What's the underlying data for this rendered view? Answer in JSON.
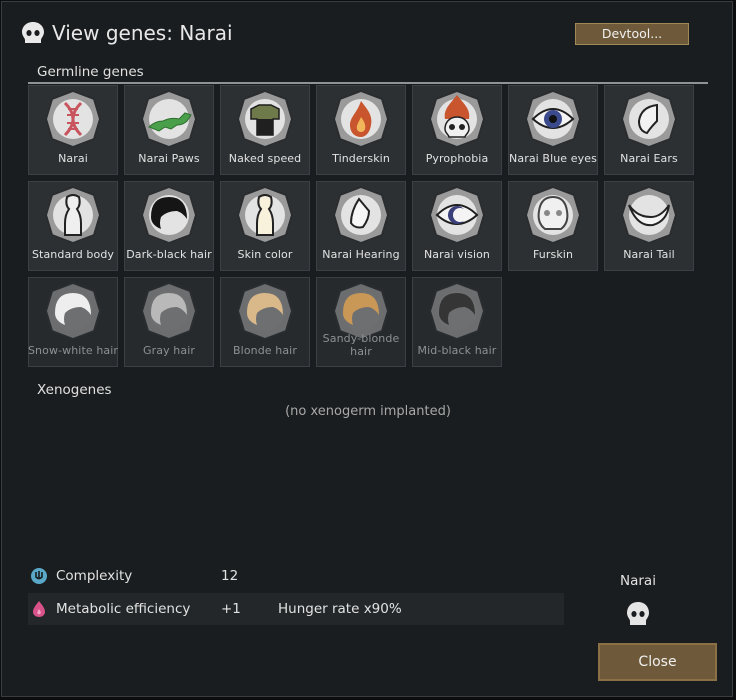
{
  "window": {
    "title": "View genes: Narai",
    "devtool_label": "Devtool..."
  },
  "germline": {
    "label": "Germline genes",
    "genes": [
      {
        "label": "Narai",
        "icon": "dna-icon",
        "active": true
      },
      {
        "label": "Narai Paws",
        "icon": "running-animal-icon",
        "active": true
      },
      {
        "label": "Naked speed",
        "icon": "armor-icon",
        "active": true
      },
      {
        "label": "Tinderskin",
        "icon": "flame-icon",
        "active": true
      },
      {
        "label": "Pyrophobia",
        "icon": "skull-flame-icon",
        "active": true
      },
      {
        "label": "Narai Blue eyes",
        "icon": "blue-eye-icon",
        "active": true
      },
      {
        "label": "Narai Ears",
        "icon": "ear-icon",
        "active": true
      },
      {
        "label": "Standard body",
        "icon": "body-icon",
        "active": true
      },
      {
        "label": "Dark-black hair",
        "icon": "hair-icon",
        "active": true
      },
      {
        "label": "Skin color",
        "icon": "skin-icon",
        "active": true
      },
      {
        "label": "Narai Hearing",
        "icon": "ear-icon",
        "active": true
      },
      {
        "label": "Narai vision",
        "icon": "eye-icon",
        "active": true
      },
      {
        "label": "Furskin",
        "icon": "fur-face-icon",
        "active": true
      },
      {
        "label": "Narai Tail",
        "icon": "tail-icon",
        "active": true
      },
      {
        "label": "Snow-white hair",
        "icon": "hair-icon",
        "active": false
      },
      {
        "label": "Gray hair",
        "icon": "hair-icon",
        "active": false
      },
      {
        "label": "Blonde hair",
        "icon": "hair-icon",
        "active": false
      },
      {
        "label": "Sandy-blonde hair",
        "icon": "hair-icon",
        "active": false
      },
      {
        "label": "Mid-black hair",
        "icon": "hair-icon",
        "active": false
      }
    ]
  },
  "xenogenes": {
    "label": "Xenogenes",
    "empty_text": "(no xenogerm implanted)"
  },
  "stats": [
    {
      "name": "Complexity",
      "value": "12",
      "extra": "",
      "icon": "complexity-icon"
    },
    {
      "name": "Metabolic efficiency",
      "value": "+1",
      "extra": "Hunger rate x90%",
      "icon": "metabolism-icon"
    }
  ],
  "pawn": {
    "name": "Narai",
    "icon": "pawn-head-icon"
  },
  "close_label": "Close",
  "colors": {
    "background": "#1a1d1f",
    "gene_tile": "#2c3033",
    "button": "#6e5a3a",
    "complexity_icon": "#59a8c8",
    "metabolism_icon": "#d9538a"
  }
}
